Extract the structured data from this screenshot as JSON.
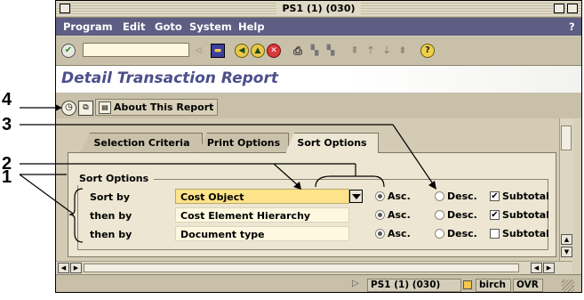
{
  "window": {
    "title": "PS1 (1) (030)"
  },
  "menubar": {
    "items": [
      "Program",
      "Edit",
      "Goto",
      "System",
      "Help"
    ],
    "help_glyph": "?"
  },
  "toolbar": {
    "command_field": {
      "value": "",
      "placeholder": ""
    },
    "icons": [
      "enter-icon",
      "back-icon",
      "save-icon",
      "back-green-icon",
      "exit-icon",
      "cancel-icon",
      "print-icon",
      "find-icon",
      "find-next-icon",
      "first-page-icon",
      "previous-page-icon",
      "next-page-icon",
      "last-page-icon",
      "help-icon"
    ]
  },
  "header": {
    "title": "Detail Transaction Report"
  },
  "app_toolbar": {
    "about_label": "About This Report"
  },
  "tabs": [
    {
      "label": "Selection Criteria",
      "active": false
    },
    {
      "label": "Print Options",
      "active": false
    },
    {
      "label": "Sort Options",
      "active": true
    }
  ],
  "sort_group": {
    "title": "Sort Options",
    "rows": [
      {
        "label": "Sort by",
        "value": "Cost Object",
        "order_asc": "Asc.",
        "order_desc": "Desc.",
        "selected": "asc",
        "subtotal_label": "Subtotal",
        "subtotal_checked": true
      },
      {
        "label": "then by",
        "value": "Cost Element Hierarchy",
        "order_asc": "Asc.",
        "order_desc": "Desc.",
        "selected": "asc",
        "subtotal_label": "Subtotal",
        "subtotal_checked": true
      },
      {
        "label": "then by",
        "value": "Document type",
        "order_asc": "Asc.",
        "order_desc": "Desc.",
        "selected": "asc",
        "subtotal_label": "Subtotal",
        "subtotal_checked": false
      }
    ]
  },
  "statusbar": {
    "system": "PS1 (1) (030)",
    "server": "birch",
    "mode": "OVR"
  },
  "callouts": [
    "1",
    "2",
    "3",
    "4"
  ],
  "colors": {
    "menubar_bg": "#5e5d84",
    "title_text": "#4d4f8a",
    "highlight_field": "#ffe38a"
  }
}
